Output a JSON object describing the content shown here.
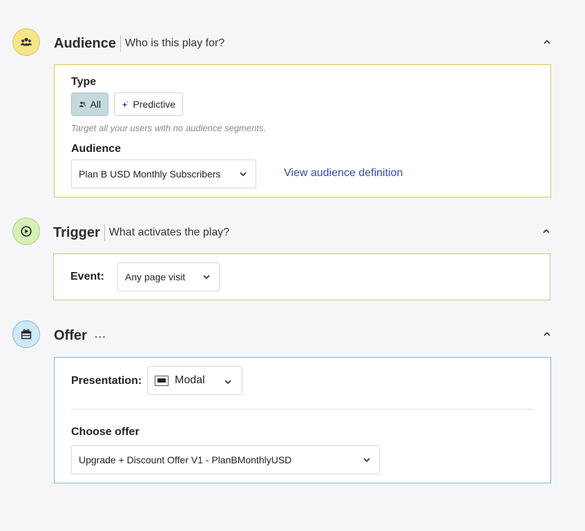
{
  "audience": {
    "title": "Audience",
    "subtitle": "Who is this play for?",
    "type_label": "Type",
    "types": [
      {
        "label": "All",
        "selected": true
      },
      {
        "label": "Predictive",
        "selected": false
      }
    ],
    "hint": "Target all your users with no audience segments.",
    "audience_label": "Audience",
    "audience_value": "Plan B USD Monthly Subscribers",
    "view_definition_link": "View audience definition"
  },
  "trigger": {
    "title": "Trigger",
    "subtitle": "What activates the play?",
    "event_label": "Event:",
    "event_value": "Any page visit"
  },
  "offer": {
    "title": "Offer",
    "more_label": "…",
    "presentation_label": "Presentation:",
    "presentation_value": "Modal",
    "choose_offer_label": "Choose offer",
    "offer_value": "Upgrade + Discount Offer V1 - PlanBMonthlyUSD"
  },
  "colors": {
    "audience_accent": "#e2c54a",
    "trigger_accent": "#a9d77c",
    "offer_accent": "#7fb6d8",
    "link": "#2f4aa8",
    "selected_toggle": "#c4d9dc"
  },
  "icons": [
    "users-icon",
    "play-circle-icon",
    "gift-icon",
    "chevron-up-icon",
    "chevron-down-icon",
    "sparkle-icon",
    "modal-icon"
  ]
}
